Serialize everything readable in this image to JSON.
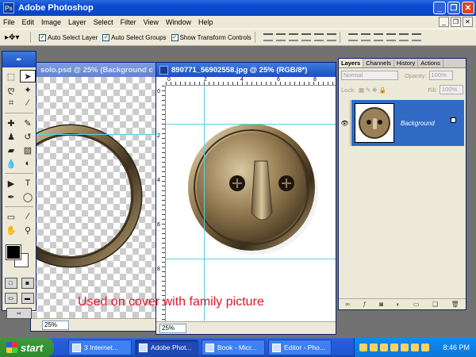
{
  "window": {
    "title": "Adobe Photoshop",
    "minimize": "_",
    "maximize": "❐",
    "close": "✕"
  },
  "menu": [
    "File",
    "Edit",
    "Image",
    "Layer",
    "Select",
    "Filter",
    "View",
    "Window",
    "Help"
  ],
  "options": {
    "auto_select_layer": "Auto Select Layer",
    "auto_select_groups": "Auto Select Groups",
    "show_transform_controls": "Show Transform Controls",
    "check": "✓"
  },
  "doc_left": {
    "title": "solo.psd @ 25% (Background c",
    "zoom": "25%"
  },
  "doc_right": {
    "title": "890771_56902558.jpg @ 25% (RGB/8*)",
    "zoom": "25%",
    "ruler_top": [
      "0",
      "2",
      "4",
      "6",
      "8"
    ],
    "ruler_left": [
      "0",
      "2",
      "4",
      "6",
      "8"
    ]
  },
  "layers": {
    "tabs": [
      "Layers",
      "Channels",
      "History",
      "Actions"
    ],
    "blend_mode": "Normal",
    "opacity_label": "Opacity:",
    "opacity": "100%",
    "lock_label": "Lock:",
    "fill_label": "Fill:",
    "fill": "100%",
    "items": [
      {
        "name": "Background"
      }
    ]
  },
  "annotation": "Used on cover with family picture",
  "taskbar": {
    "start": "start",
    "tasks": [
      "3 Internet...",
      "Adobe Phot...",
      "Book - Micr...",
      "Editor - Pho..."
    ],
    "clock": "8:46 PM"
  },
  "colors": {
    "accent": "#0a4ad1",
    "layer_selected": "#316ac5",
    "annotation": "#e2152b",
    "guide": "#5ad2e0"
  }
}
